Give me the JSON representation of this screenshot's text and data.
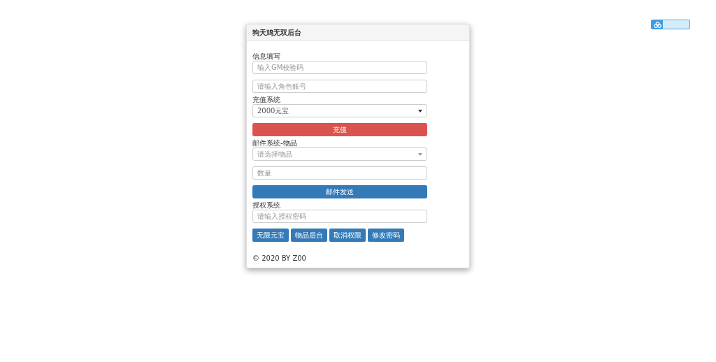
{
  "panel": {
    "title": "狗天鸡无双后台",
    "sections": [
      {
        "label": "信息填写",
        "fields": [
          {
            "kind": "input",
            "placeholder": "输入GM校验码"
          },
          {
            "kind": "input",
            "placeholder": "请输入角色账号"
          }
        ]
      },
      {
        "label": "充值系统",
        "fields": [
          {
            "kind": "select",
            "value": "2000元宝"
          },
          {
            "kind": "button",
            "label": "充值",
            "color": "#d9534f"
          }
        ]
      },
      {
        "label": "邮件系统-物品",
        "fields": [
          {
            "kind": "select",
            "placeholder": "请选择物品"
          },
          {
            "kind": "input",
            "placeholder": "数量"
          },
          {
            "kind": "button",
            "label": "邮件发送",
            "color": "#337ab7"
          }
        ]
      },
      {
        "label": "授权系统",
        "fields": [
          {
            "kind": "input",
            "placeholder": "请输入授权密码"
          }
        ]
      }
    ],
    "actions": [
      "无限元宝",
      "物品后台",
      "取消权限",
      "修改密码"
    ],
    "footer": "© 2020 BY Z00"
  }
}
